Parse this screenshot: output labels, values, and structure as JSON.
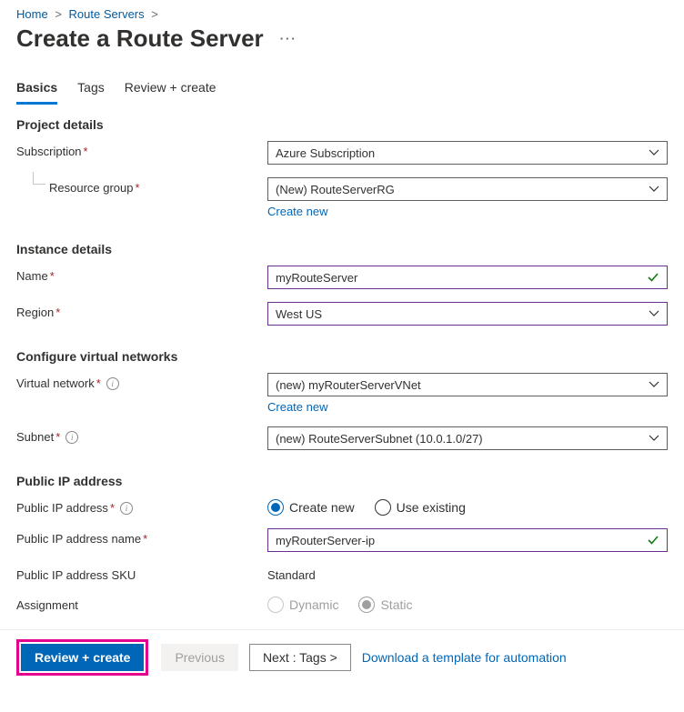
{
  "breadcrumbs": {
    "home": "Home",
    "routeServers": "Route Servers"
  },
  "title": "Create a Route Server",
  "moreGlyph": "···",
  "tabs": {
    "basics": "Basics",
    "tags": "Tags",
    "review": "Review + create"
  },
  "sections": {
    "project": "Project details",
    "instance": "Instance details",
    "vnet": "Configure virtual networks",
    "pip": "Public IP address"
  },
  "labels": {
    "subscription": "Subscription",
    "resourceGroup": "Resource group",
    "createNew": "Create new",
    "name": "Name",
    "region": "Region",
    "virtualNetwork": "Virtual network",
    "subnet": "Subnet",
    "publicIp": "Public IP address",
    "publicIpName": "Public IP address name",
    "publicIpSku": "Public IP address SKU",
    "assignment": "Assignment"
  },
  "values": {
    "subscription": "Azure Subscription",
    "resourceGroup": "(New) RouteServerRG",
    "name": "myRouteServer",
    "region": "West US",
    "virtualNetwork": "(new) myRouterServerVNet",
    "subnet": "(new) RouteServerSubnet (10.0.1.0/27)",
    "publicIpName": "myRouterServer-ip",
    "publicIpSku": "Standard"
  },
  "radios": {
    "createNew": "Create new",
    "useExisting": "Use existing",
    "dynamic": "Dynamic",
    "static": "Static"
  },
  "footer": {
    "review": "Review + create",
    "previous": "Previous",
    "next": "Next : Tags >",
    "download": "Download a template for automation"
  }
}
